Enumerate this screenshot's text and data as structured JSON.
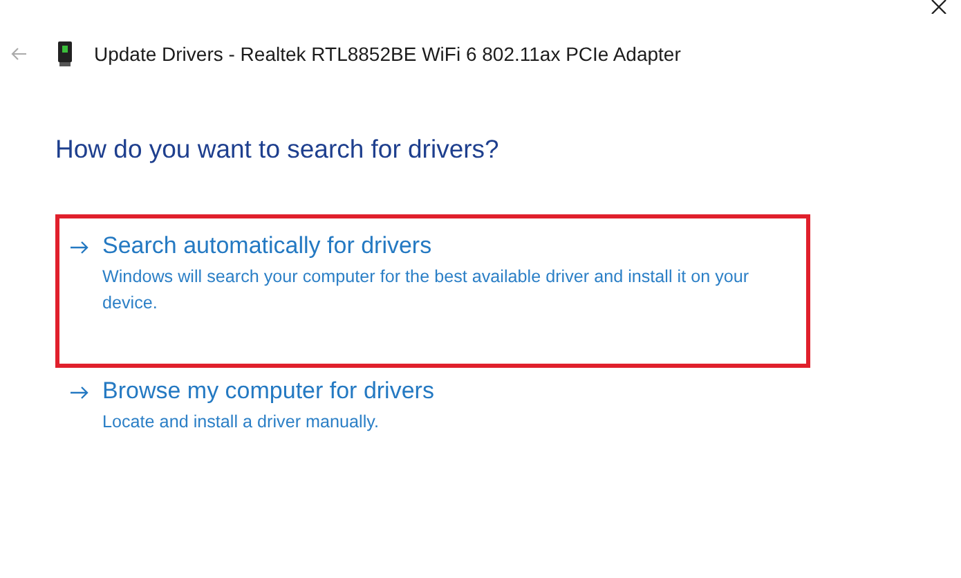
{
  "window": {
    "title": "Update Drivers - Realtek RTL8852BE WiFi 6 802.11ax PCIe Adapter"
  },
  "heading": "How do you want to search for drivers?",
  "options": [
    {
      "title": "Search automatically for drivers",
      "description": "Windows will search your computer for the best available driver and install it on your device.",
      "highlighted": true
    },
    {
      "title": "Browse my computer for drivers",
      "description": "Locate and install a driver manually.",
      "highlighted": false
    }
  ]
}
